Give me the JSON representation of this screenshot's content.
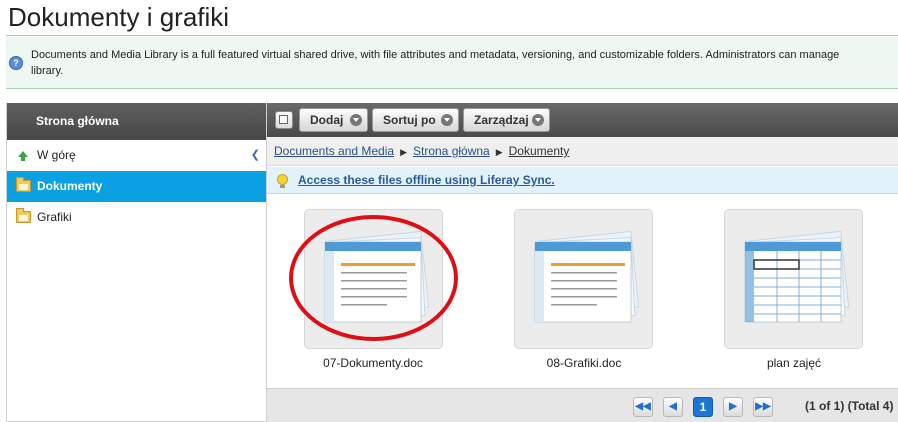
{
  "page": {
    "title": "Dokumenty i grafiki"
  },
  "info": {
    "line1": "Documents and Media Library is a full featured virtual shared drive, with file attributes and metadata, versioning, and customizable folders. Administrators can manage",
    "line2": "library."
  },
  "sidebar": {
    "header": "Strona główna",
    "items": [
      {
        "label": "W górę",
        "icon": "up-arrow-icon"
      },
      {
        "label": "Dokumenty",
        "icon": "folder-icon",
        "active": true
      },
      {
        "label": "Grafiki",
        "icon": "folder-icon"
      }
    ]
  },
  "toolbar": {
    "add_label": "Dodaj",
    "sort_label": "Sortuj po",
    "manage_label": "Zarządzaj"
  },
  "breadcrumb": {
    "items": [
      "Documents and Media",
      "Strona główna",
      "Dokumenty"
    ]
  },
  "sync": {
    "link": "Access these files offline using Liferay Sync."
  },
  "files": [
    {
      "name": "07-Dokumenty.doc",
      "type": "doc"
    },
    {
      "name": "08-Grafiki.doc",
      "type": "doc"
    },
    {
      "name": "plan zajęć",
      "type": "spreadsheet"
    }
  ],
  "pagination": {
    "current": "1",
    "info": "(1 of 1) (Total 4)"
  },
  "colors": {
    "accent": "#0aa0e2",
    "highlight_circle": "#e10d14",
    "toolbar": "#555555"
  }
}
